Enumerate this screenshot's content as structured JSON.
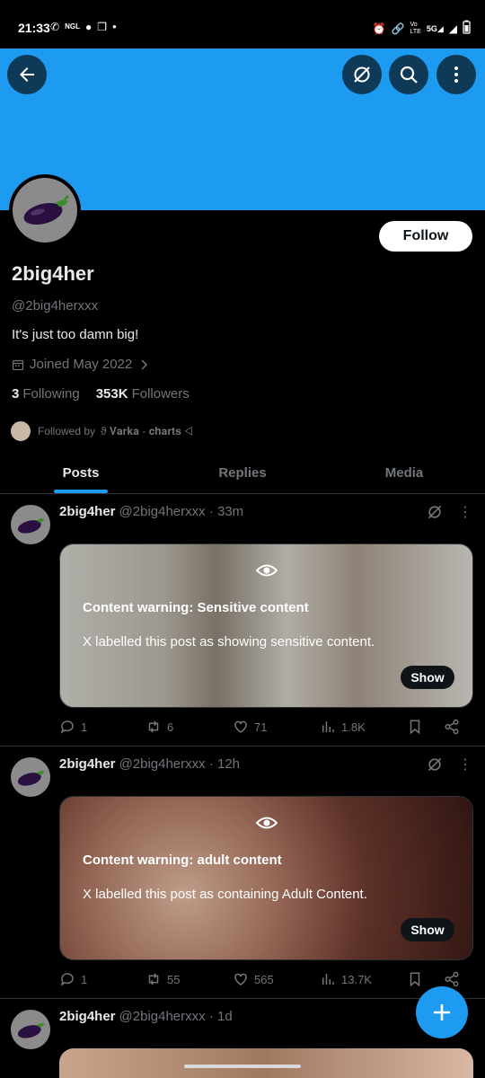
{
  "status_bar": {
    "time": "21:33",
    "left_icons": [
      "whatsapp-icon",
      "ngl-icon",
      "chat-icon",
      "copy-icon",
      "dot-icon"
    ],
    "right_icons": [
      "alarm-icon",
      "link-icon",
      "volte-icon",
      "5g-signal-icon",
      "signal-icon",
      "battery-icon"
    ],
    "network": "5G"
  },
  "banner": {
    "color": "#1d9bf0"
  },
  "profile": {
    "avatar_icon": "eggplant-icon",
    "follow_label": "Follow",
    "name": "2big4her",
    "handle": "@2big4herxxx",
    "bio": "It's just too damn big!",
    "joined": "Joined May 2022",
    "following_count": "3",
    "following_label": "Following",
    "followers_count": "353K",
    "followers_label": "Followers",
    "followed_by_prefix": "Followed by",
    "followed_by_name": "ϑ 𝐕𝐚𝐫𝐤𝐚 - 𝐜𝐡𝐚𝐫𝐭𝐬 ⨞"
  },
  "tabs": [
    {
      "label": "Posts",
      "active": true
    },
    {
      "label": "Replies",
      "active": false
    },
    {
      "label": "Media",
      "active": false
    }
  ],
  "posts": [
    {
      "name": "2big4her",
      "handle": "@2big4herxxx",
      "time": "· 33m",
      "warning_title": "Content warning: Sensitive content",
      "warning_text": "X labelled this post as showing sensitive content.",
      "show_label": "Show",
      "replies": "1",
      "reposts": "6",
      "likes": "71",
      "views": "1.8K"
    },
    {
      "name": "2big4her",
      "handle": "@2big4herxxx",
      "time": "· 12h",
      "warning_title": "Content warning: adult content",
      "warning_text": "X labelled this post as containing Adult Content.",
      "show_label": "Show",
      "replies": "1",
      "reposts": "55",
      "likes": "565",
      "views": "13.7K"
    },
    {
      "name": "2big4her",
      "handle": "@2big4herxxx",
      "time": "· 1d"
    }
  ],
  "fab": {
    "icon": "plus-icon"
  },
  "colors": {
    "accent": "#1d9bf0",
    "background": "#000000",
    "muted": "#71767b"
  }
}
